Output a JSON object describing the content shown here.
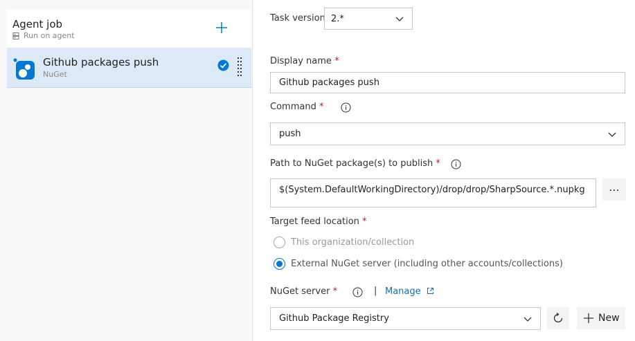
{
  "pipeline": {
    "agent_job": {
      "title": "Agent job",
      "subtitle": "Run on agent"
    },
    "task": {
      "title": "Github packages push",
      "subtitle": "NuGet"
    }
  },
  "form": {
    "task_version": {
      "label": "Task version",
      "value": "2.*"
    },
    "display_name": {
      "label": "Display name",
      "required": "*",
      "value": "Github packages push"
    },
    "command": {
      "label": "Command",
      "required": "*",
      "value": "push"
    },
    "path": {
      "label": "Path to NuGet package(s) to publish",
      "required": "*",
      "value": "$(System.DefaultWorkingDirectory)/drop/drop/SharpSource.*.nupkg",
      "browse_label": "⋯"
    },
    "target_feed": {
      "label": "Target feed location",
      "required": "*",
      "options": [
        {
          "label": "This organization/collection",
          "selected": false
        },
        {
          "label": "External NuGet server (including other accounts/collections)",
          "selected": true
        }
      ]
    },
    "nuget_server": {
      "label": "NuGet server",
      "required": "*",
      "separator": "|",
      "manage_label": "Manage",
      "value": "Github Package Registry",
      "new_label": "New"
    }
  },
  "colors": {
    "accent": "#0078d4",
    "selected_row": "#dce9f6",
    "required": "#a4262c",
    "link": "#106ebe"
  },
  "icons": [
    "server-icon",
    "plus-icon",
    "nuget-task-icon",
    "checkmark-circle-icon",
    "drag-handle-icon",
    "chevron-down-icon",
    "info-icon",
    "external-link-icon",
    "refresh-icon"
  ]
}
